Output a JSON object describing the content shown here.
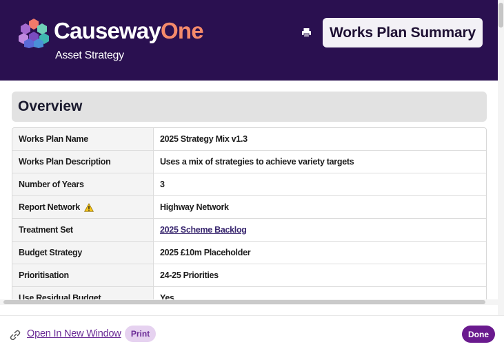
{
  "header": {
    "brand_primary": "Causeway",
    "brand_secondary": "One",
    "subtitle": "Asset Strategy",
    "title": "Works Plan Summary",
    "print_icon": "printer-icon",
    "logo_icon": "causeway-hexagon-logo"
  },
  "overview": {
    "heading": "Overview",
    "rows": [
      {
        "label": "Works Plan Name",
        "value": "2025 Strategy Mix v1.3"
      },
      {
        "label": "Works Plan Description",
        "value": "Uses a mix of strategies to achieve variety targets"
      },
      {
        "label": "Number of Years",
        "value": "3"
      },
      {
        "label": "Report Network",
        "value": "Highway Network",
        "icon": "warning-icon"
      },
      {
        "label": "Treatment Set",
        "value": "2025 Scheme Backlog",
        "link": true
      },
      {
        "label": "Budget Strategy",
        "value": "2025 £10m Placeholder"
      },
      {
        "label": "Prioritisation",
        "value": "24-25 Priorities"
      },
      {
        "label": "Use Residual Budget",
        "value": "Yes"
      }
    ]
  },
  "footer": {
    "open_link": "Open In New Window",
    "link_icon": "chain-link-icon",
    "print_label": "Print",
    "done_label": "Done"
  },
  "colors": {
    "header_bg": "#2a1050",
    "accent": "#6a1a8e",
    "brand_orange": "#f58a6b",
    "print_btn_bg": "#e6d2f0"
  }
}
